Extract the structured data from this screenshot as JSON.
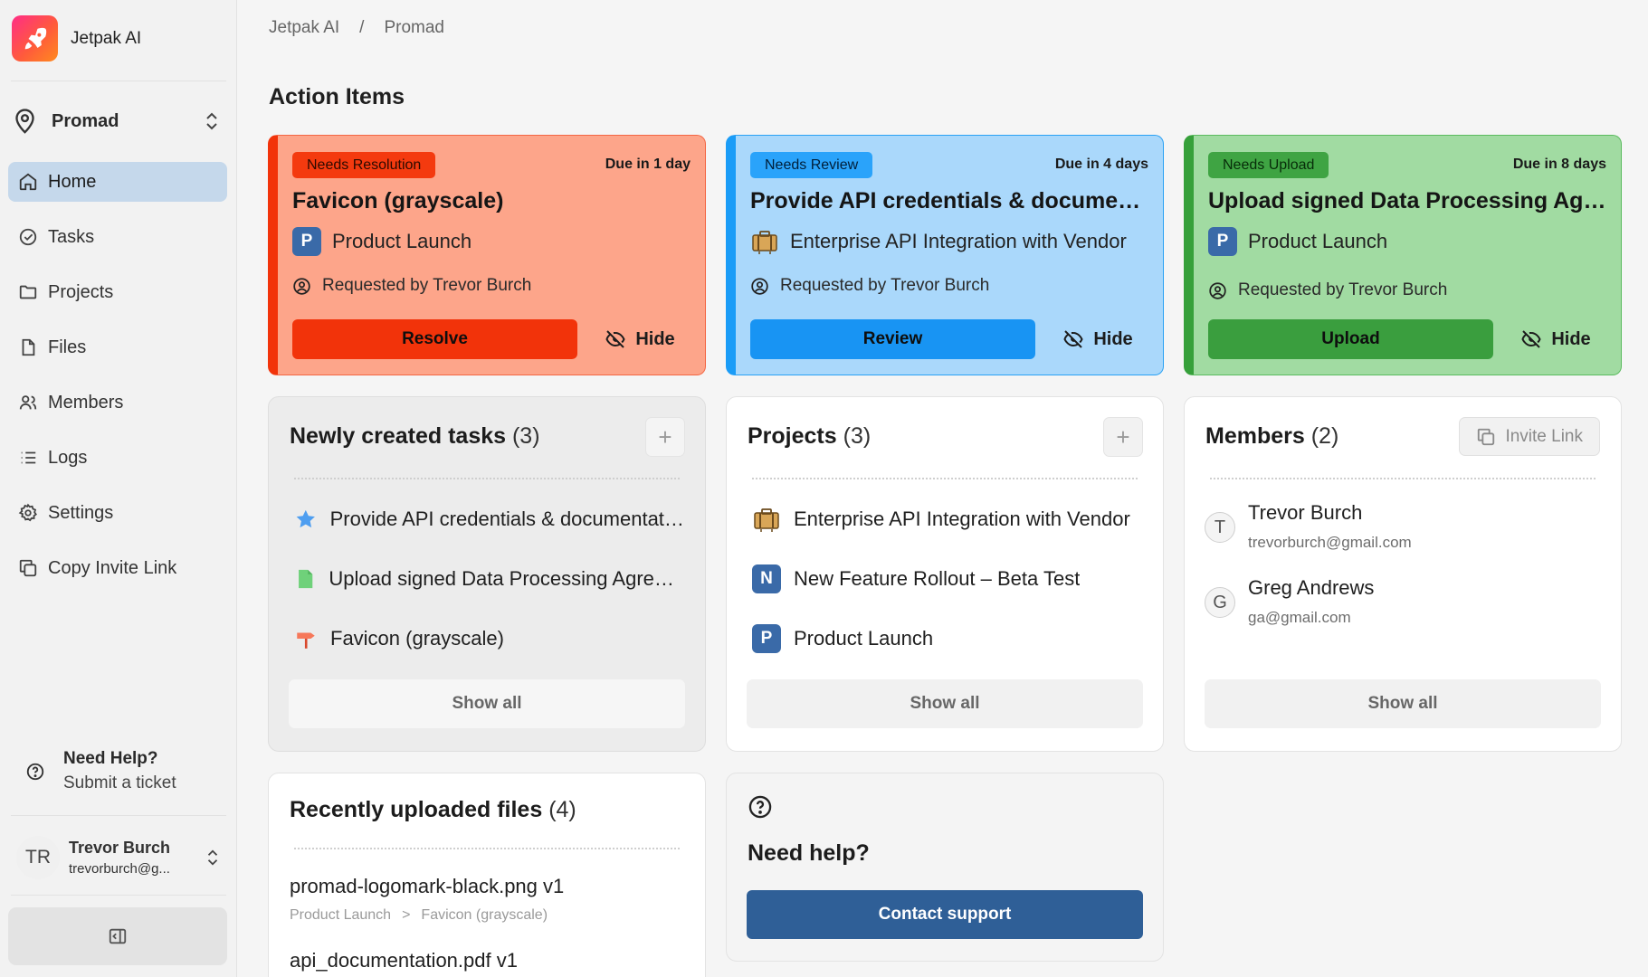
{
  "app": {
    "name": "Jetpak AI"
  },
  "workspace": {
    "name": "Promad"
  },
  "nav": [
    {
      "label": "Home",
      "icon": "home-icon",
      "active": true
    },
    {
      "label": "Tasks",
      "icon": "tasks-icon"
    },
    {
      "label": "Projects",
      "icon": "folder-icon"
    },
    {
      "label": "Files",
      "icon": "file-icon"
    },
    {
      "label": "Members",
      "icon": "members-icon"
    },
    {
      "label": "Logs",
      "icon": "list-icon"
    },
    {
      "label": "Settings",
      "icon": "gear-icon"
    },
    {
      "label": "Copy Invite Link",
      "icon": "copy-icon"
    }
  ],
  "help": {
    "title": "Need Help?",
    "subtitle": "Submit a ticket"
  },
  "user": {
    "initials": "TR",
    "name": "Trevor Burch",
    "email": "trevorburch@g..."
  },
  "breadcrumb": {
    "root": "Jetpak AI",
    "separator": "/",
    "current": "Promad"
  },
  "action_items": {
    "title": "Action Items",
    "cards": [
      {
        "badge": "Needs Resolution",
        "due": "Due in 1 day",
        "title": "Favicon (grayscale)",
        "project_initial": "P",
        "project": "Product Launch",
        "requested": "Requested by Trevor Burch",
        "button": "Resolve",
        "hide": "Hide",
        "accent": "#f2330a"
      },
      {
        "badge": "Needs Review",
        "due": "Due in 4 days",
        "title": "Provide API credentials & documentation",
        "project": "Enterprise API Integration with Vendor",
        "requested": "Requested by Trevor Burch",
        "button": "Review",
        "hide": "Hide",
        "accent": "#1894f3"
      },
      {
        "badge": "Needs Upload",
        "due": "Due in 8 days",
        "title": "Upload signed Data Processing Agreement",
        "project_initial": "P",
        "project": "Product Launch",
        "requested": "Requested by Trevor Burch",
        "button": "Upload",
        "hide": "Hide",
        "accent": "#3a9e3e"
      }
    ]
  },
  "tasks_card": {
    "title": "Newly created tasks",
    "count": "(3)",
    "items": [
      {
        "label": "Provide API credentials & documentation",
        "icon": "star-icon"
      },
      {
        "label": "Upload signed Data Processing Agreement",
        "icon": "document-icon"
      },
      {
        "label": "Favicon (grayscale)",
        "icon": "signpost-icon"
      }
    ],
    "show_all": "Show all"
  },
  "projects_card": {
    "title": "Projects",
    "count": "(3)",
    "items": [
      {
        "label": "Enterprise API Integration with Vendor",
        "icon": "briefcase-icon"
      },
      {
        "initial": "N",
        "label": "New Feature Rollout – Beta Test"
      },
      {
        "initial": "P",
        "label": "Product Launch"
      }
    ],
    "show_all": "Show all"
  },
  "members_card": {
    "title": "Members",
    "count": "(2)",
    "invite": "Invite Link",
    "members": [
      {
        "initial": "T",
        "name": "Trevor Burch",
        "email": "trevorburch@gmail.com"
      },
      {
        "initial": "G",
        "name": "Greg Andrews",
        "email": "ga@gmail.com"
      }
    ],
    "show_all": "Show all"
  },
  "files_card": {
    "title": "Recently uploaded files",
    "count": "(4)",
    "files": [
      {
        "name": "promad-logomark-black.png v1",
        "path_project": "Product Launch",
        "path_sep": ">",
        "path_task": "Favicon (grayscale)"
      },
      {
        "name": "api_documentation.pdf v1"
      }
    ]
  },
  "help_card": {
    "title": "Need help?",
    "button": "Contact support"
  }
}
